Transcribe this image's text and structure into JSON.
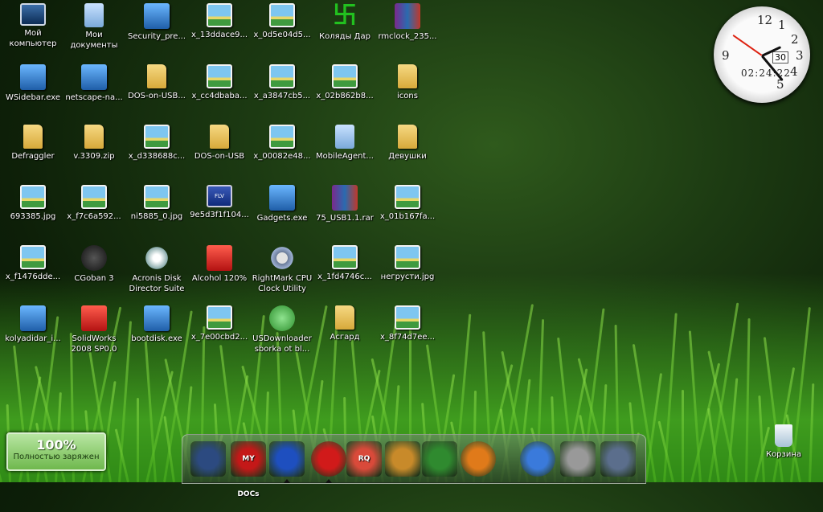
{
  "desktop_icons": [
    {
      "label": "Мой\nкомпьютер",
      "icon": "my-computer-icon",
      "kind": "pc"
    },
    {
      "label": "Мои\nдокументы",
      "icon": "my-documents-icon",
      "kind": "docs"
    },
    {
      "label": "Security_pre...",
      "icon": "security-app-icon",
      "kind": "exe"
    },
    {
      "label": "x_13ddace9...",
      "icon": "image-file-icon",
      "kind": "img"
    },
    {
      "label": "x_0d5e04d5...",
      "icon": "image-file-icon",
      "kind": "img"
    },
    {
      "label": "Коляды Дар",
      "icon": "symbol-icon",
      "kind": "swastika"
    },
    {
      "label": "rmclock_235...",
      "icon": "archive-icon",
      "kind": "rar"
    },
    {
      "label": "WSidebar.exe",
      "icon": "sidebar-app-icon",
      "kind": "exe"
    },
    {
      "label": "netscape-na...",
      "icon": "installer-disc-icon",
      "kind": "exe"
    },
    {
      "label": "DOS-on-USB...",
      "icon": "zip-folder-icon",
      "kind": "folder"
    },
    {
      "label": "x_cc4dbaba...",
      "icon": "image-file-icon",
      "kind": "img"
    },
    {
      "label": "x_a3847cb5...",
      "icon": "image-file-icon",
      "kind": "img"
    },
    {
      "label": "x_02b862b8...",
      "icon": "image-file-icon",
      "kind": "img"
    },
    {
      "label": "icons",
      "icon": "folder-icon",
      "kind": "folder"
    },
    {
      "label": "Defraggler",
      "icon": "folder-icon",
      "kind": "folder"
    },
    {
      "label": "v.3309.zip",
      "icon": "zip-folder-icon",
      "kind": "folder"
    },
    {
      "label": "x_d338688c...",
      "icon": "image-file-icon",
      "kind": "img"
    },
    {
      "label": "DOS-on-USB",
      "icon": "folder-icon",
      "kind": "folder"
    },
    {
      "label": "x_00082e48...",
      "icon": "image-file-icon",
      "kind": "img"
    },
    {
      "label": "MobileAgent...",
      "icon": "document-icon",
      "kind": "docs"
    },
    {
      "label": "Девушки",
      "icon": "folder-icon",
      "kind": "folder"
    },
    {
      "label": "693385.jpg",
      "icon": "image-file-icon",
      "kind": "img"
    },
    {
      "label": "x_f7c6a592...",
      "icon": "image-file-icon",
      "kind": "img"
    },
    {
      "label": "ni5885_0.jpg",
      "icon": "image-file-icon",
      "kind": "img"
    },
    {
      "label": "9e5d3f1f104...",
      "icon": "flv-video-icon",
      "kind": "flv"
    },
    {
      "label": "Gadgets.exe",
      "icon": "gadgets-app-icon",
      "kind": "exe"
    },
    {
      "label": "75_USB1.1.rar",
      "icon": "archive-icon",
      "kind": "rar"
    },
    {
      "label": "x_01b167fa...",
      "icon": "image-file-icon",
      "kind": "img"
    },
    {
      "label": "x_f1476dde...",
      "icon": "image-file-icon",
      "kind": "img"
    },
    {
      "label": "CGoban 3",
      "icon": "cgoban-icon",
      "kind": "dark"
    },
    {
      "label": "Acronis Disk\nDirector Suite",
      "icon": "acronis-icon",
      "kind": "acronis"
    },
    {
      "label": "Alcohol 120%",
      "icon": "alcohol-icon",
      "kind": "red"
    },
    {
      "label": "RightMark CPU\nClock Utility",
      "icon": "gear-icon",
      "kind": "gear"
    },
    {
      "label": "x_1fd4746c...",
      "icon": "image-file-icon",
      "kind": "img"
    },
    {
      "label": "негрусти.jpg",
      "icon": "image-file-icon",
      "kind": "img"
    },
    {
      "label": "kolyadidar_i...",
      "icon": "installer-icon",
      "kind": "exe"
    },
    {
      "label": "SolidWorks\n2008 SP0.0",
      "icon": "solidworks-icon",
      "kind": "red"
    },
    {
      "label": "bootdisk.exe",
      "icon": "bootdisk-icon",
      "kind": "exe"
    },
    {
      "label": "x_7e00cbd2...",
      "icon": "image-file-icon",
      "kind": "img"
    },
    {
      "label": "USDownloader\nsborka ot bl...",
      "icon": "downloader-icon",
      "kind": "green"
    },
    {
      "label": "Асгард",
      "icon": "folder-icon",
      "kind": "folder"
    },
    {
      "label": "x_8f74d7ee...",
      "icon": "image-file-icon",
      "kind": "img"
    }
  ],
  "clock": {
    "numbers": [
      "12",
      "1",
      "2",
      "3",
      "4",
      "5",
      "9"
    ],
    "time": "02:24:22",
    "date": "30"
  },
  "battery": {
    "percent": "100%",
    "status": "Полностью заряжен"
  },
  "recycle_bin": {
    "label": "Корзина"
  },
  "dock": [
    {
      "name": "computer-icon"
    },
    {
      "name": "my-docs-icon",
      "text": "MY DOCs"
    },
    {
      "name": "save-icon"
    },
    {
      "name": "opera-icon"
    },
    {
      "name": "rq-icon",
      "text": "RQ"
    },
    {
      "name": "coyote-icon"
    },
    {
      "name": "utorrent-icon"
    },
    {
      "name": "firefox-icon"
    },
    {
      "name": "network-icon"
    },
    {
      "name": "tools-icon"
    },
    {
      "name": "trash-icon"
    }
  ],
  "colors": {
    "grass": "#3f9c1e",
    "dark_green": "#0d1f08",
    "battery": "#6fb84d"
  }
}
